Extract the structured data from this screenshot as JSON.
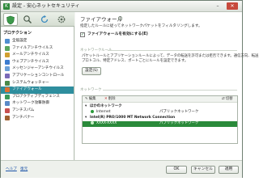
{
  "window": {
    "title": "設定 - 安心ネットセキュリティ",
    "min_glyph": "–",
    "close_glyph": "✕"
  },
  "toolbar": {
    "tools": [
      {
        "icon": "protection-shield-icon"
      },
      {
        "icon": "search-icon"
      },
      {
        "icon": "update-icon"
      },
      {
        "icon": "settings-icon"
      }
    ]
  },
  "sidebar": {
    "heading": "プロテクション",
    "items": [
      {
        "label": "全般設定",
        "color": "#4f8fd0"
      },
      {
        "label": "ファイルアンチウイルス",
        "color": "#58a65e"
      },
      {
        "label": "メールアンチウイルス",
        "color": "#d0a030"
      },
      {
        "label": "ウェブアンチウイルス",
        "color": "#3c7dd0"
      },
      {
        "label": "メッセンジャーアンチウイルス",
        "color": "#6aa0d8"
      },
      {
        "label": "アプリケーションコントロール",
        "color": "#7a6ab8"
      },
      {
        "label": "システムウォッチャー",
        "color": "#4a8a4a"
      },
      {
        "label": "ファイアウォール",
        "color": "#e07030",
        "selected": true
      },
      {
        "label": "プロアクティブディフェンス",
        "color": "#3a9a5a"
      },
      {
        "label": "ネットワーク攻撃防御",
        "color": "#5a8ac8"
      },
      {
        "label": "アンチスパム",
        "color": "#c85050"
      },
      {
        "label": "アンチバナー",
        "color": "#a06030"
      }
    ]
  },
  "content": {
    "title": "ファイアウォール",
    "help_glyph": "?",
    "description": "指定したルールに従ってネットワークパケットをフィルタリングします。",
    "enable_label": "ファイアウォールを有効にする(E)",
    "enable_checked": true,
    "rules_section": "ネットワークルール",
    "rules_text": [
      "パケットルールとアプリケーションルールによって、データの転送を許可または拒否できます。通信方向、転送",
      "プロトコル、特定アドレス、ポートごとにルールを設定できます。"
    ],
    "settings_button": "設定(S)",
    "network_section": "ネットワーク",
    "network_tools": {
      "edit": "編集",
      "delete": "削除",
      "switch": "切替"
    },
    "networks": [
      {
        "group": "ほかのネットワーク"
      },
      {
        "name": "Internet",
        "type": "パブリックネットワーク"
      },
      {
        "group": "Intel(R) PRO/1000 MT Network Connection"
      },
      {
        "name": "XXXX-XXXX",
        "type": "パブリックネットワーク",
        "selected": true
      }
    ]
  },
  "footer": {
    "help": "ヘルプ",
    "restore": "復元",
    "ok": "OK",
    "cancel": "キャンセル",
    "apply": "適用"
  }
}
